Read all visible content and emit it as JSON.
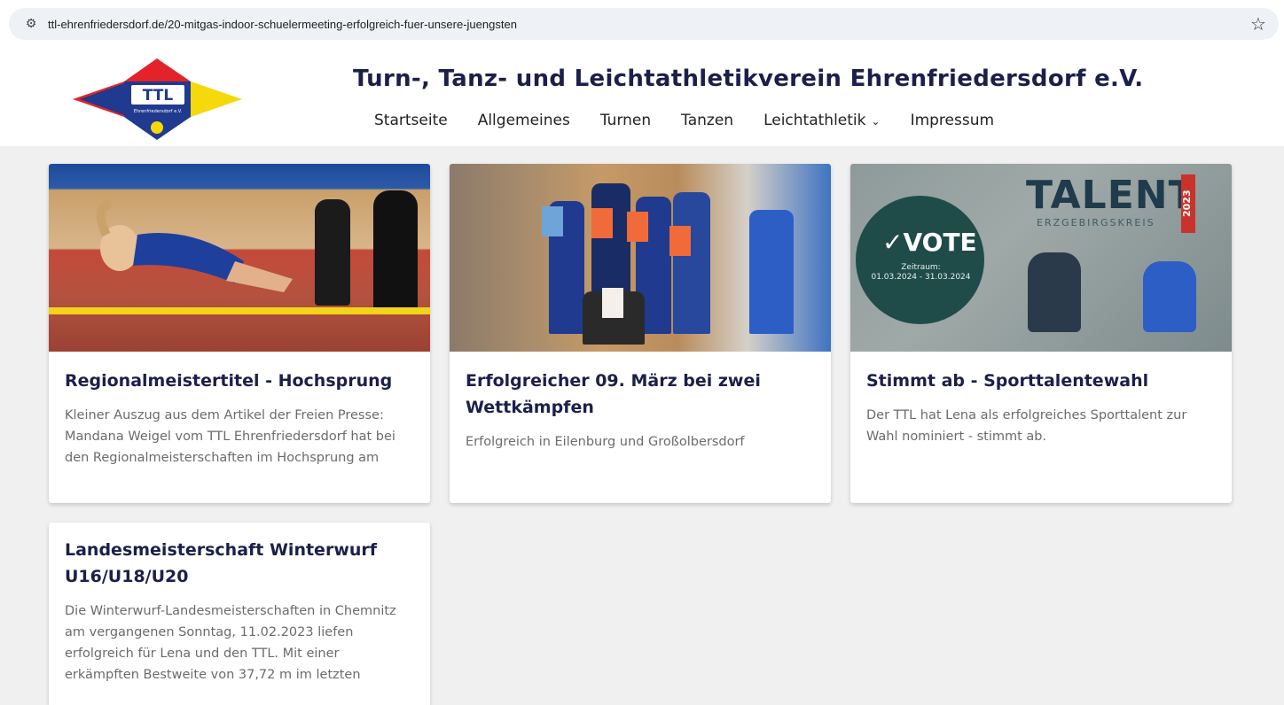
{
  "browser": {
    "url": "ttl-ehrenfriedersdorf.de/20-mitgas-indoor-schuelermeeting-erfolgreich-fuer-unsere-juengsten",
    "tune_icon": "tune-icon",
    "star_icon": "bookmark-star-icon"
  },
  "header": {
    "logo_text": "TTL",
    "logo_subtext": "Ehrenfriedersdorf e.V.",
    "site_title": "Turn-, Tanz- und Leichtathletikverein Ehrenfriedersdorf e.V.",
    "nav": [
      {
        "label": "Startseite"
      },
      {
        "label": "Allgemeines"
      },
      {
        "label": "Turnen"
      },
      {
        "label": "Tanzen"
      },
      {
        "label": "Leichtathletik"
      },
      {
        "label": "Impressum"
      }
    ]
  },
  "cards": [
    {
      "title": "Regionalmeistertitel - Hochsprung",
      "excerpt": "Kleiner Auszug aus dem Artikel der Freien Presse: Mandana Weigel vom TTL Ehrenfriedersdorf hat bei den Regionalmeisterschaften im Hochsprung am"
    },
    {
      "title": "Erfolgreicher 09. März bei zwei Wettkämpfen",
      "excerpt": "Erfolgreich in Eilenburg und Großolbersdorf"
    },
    {
      "title": "Stimmt ab - Sporttalentewahl",
      "excerpt": "Der TTL hat Lena als erfolgreiches Sporttalent zur Wahl nominiert - stimmt ab.",
      "image_text": {
        "vote": "VOTE",
        "period_label": "Zeitraum:",
        "period": "01.03.2024 - 31.03.2024",
        "talent": "TALENT",
        "region": "ERZGEBIRGSKREIS",
        "year": "2023"
      }
    },
    {
      "title": "Landesmeisterschaft Winterwurf U16/U18/U20",
      "excerpt": "Die Winterwurf-Landesmeisterschaften in Chemnitz am vergangenen Sonntag, 11.02.2023 liefen erfolgreich für Lena und den TTL. Mit einer erkämpften Bestweite von 37,72 m im letzten"
    }
  ],
  "colors": {
    "title": "#1c1f4a",
    "page_bg": "#f0f0f0",
    "card_bg": "#ffffff",
    "excerpt": "#6b6b6b"
  }
}
